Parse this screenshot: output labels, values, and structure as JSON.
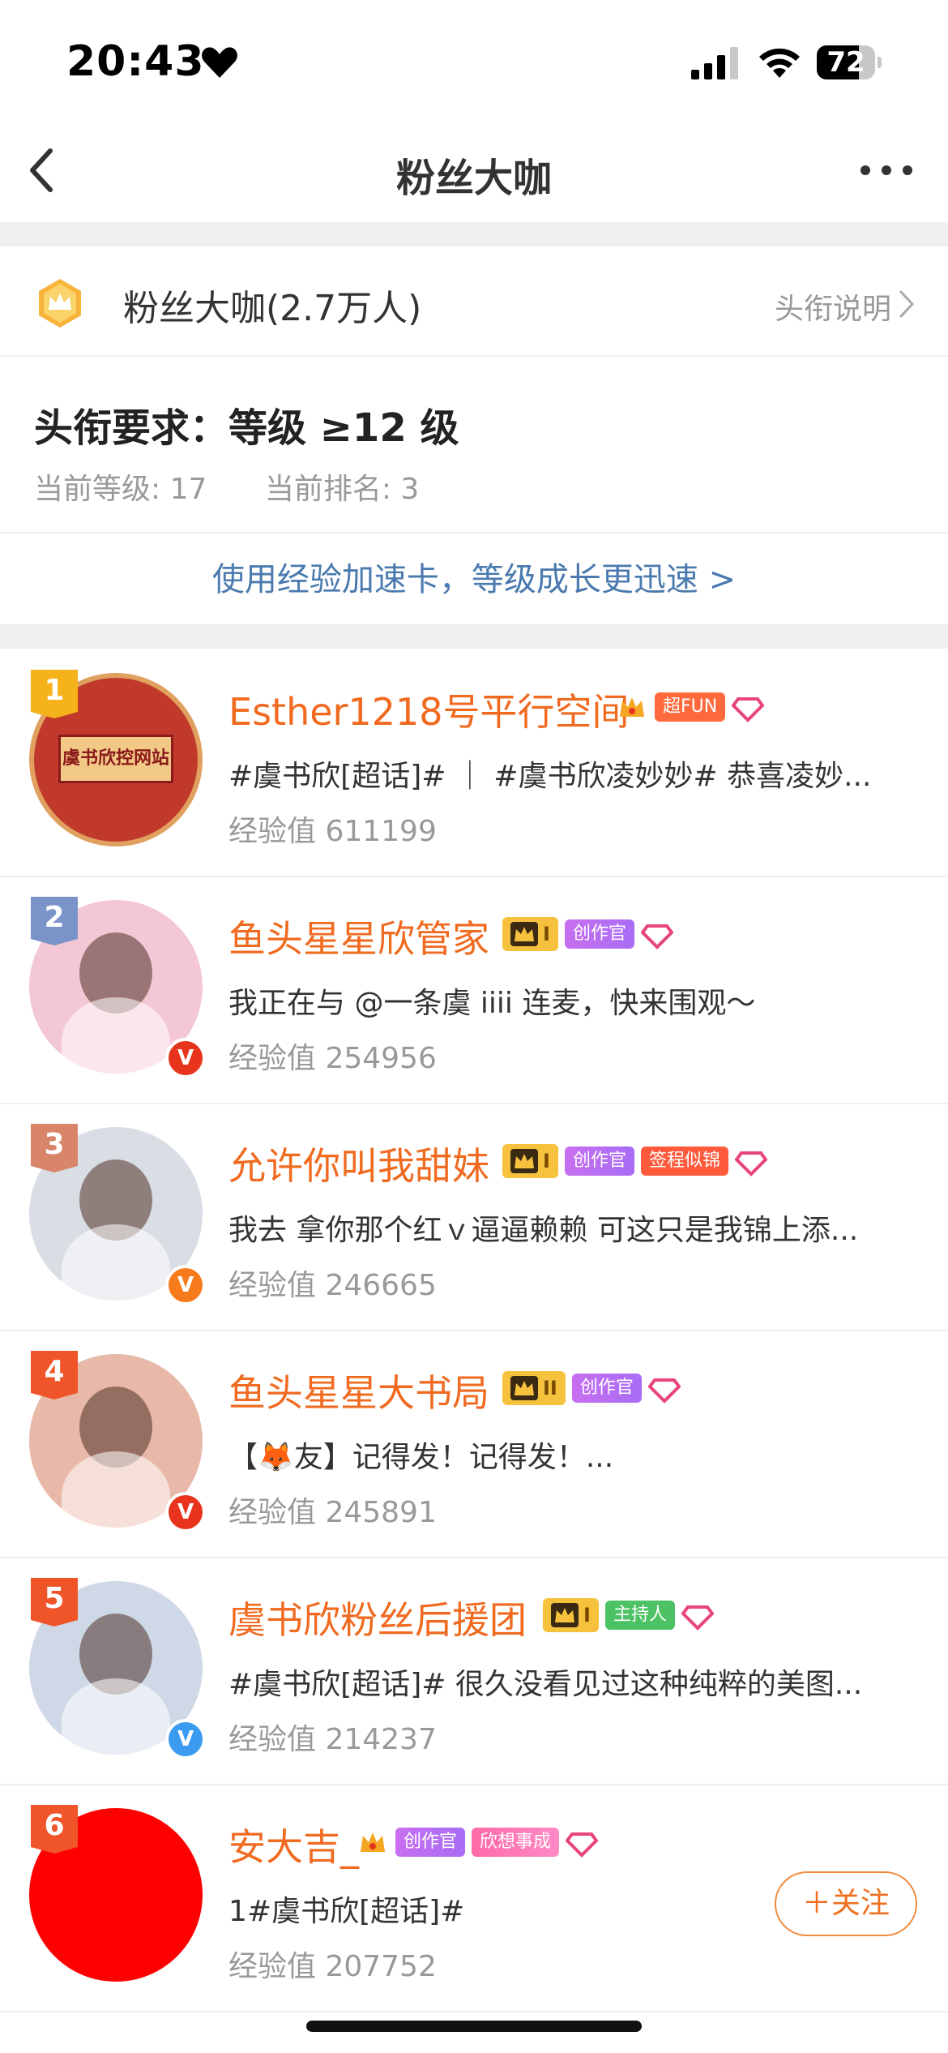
{
  "status_bar": {
    "time": "20:43",
    "battery": "72",
    "battery_level": 0.72
  },
  "nav": {
    "title": "粉丝大咖"
  },
  "group": {
    "name": "粉丝大咖(2.7万人)",
    "explain_label": "头衔说明"
  },
  "requirement": {
    "title": "头衔要求：等级 ≥12 级",
    "current_level": "当前等级: 17",
    "current_rank": "当前排名: 3"
  },
  "accel_link": "使用经验加速卡，等级成长更迅速 >",
  "ranking": [
    {
      "rank": "1",
      "name": "Esther1218号平行空间",
      "desc": "#虞书欣[超话]# ｜ #虞书欣凌妙妙# 恭喜凌妙...",
      "exp": "经验值 611199",
      "tags": [
        "超FUN"
      ],
      "avatar_color": "#c0392b",
      "verify": "",
      "avatar_text": "虞书欣控网站"
    },
    {
      "rank": "2",
      "name": "鱼头星星欣管家",
      "desc": "我正在与 @一条虞 iiii 连麦，快来围观～",
      "exp": "经验值 254956",
      "level": "I",
      "tags": [
        "创作官"
      ],
      "avatar_color": "#f4c7d6",
      "verify": "V"
    },
    {
      "rank": "3",
      "name": "允许你叫我甜妹",
      "desc": "我去 拿你那个红ｖ逼逼赖赖 可这只是我锦上添...",
      "exp": "经验值 246665",
      "level": "I",
      "tags": [
        "创作官",
        "签程似锦"
      ],
      "avatar_color": "#d9dde4",
      "verify": "V"
    },
    {
      "rank": "4",
      "name": "鱼头星星大书局",
      "desc": "【🦊友】记得发！记得发！...",
      "exp": "经验值 245891",
      "level": "II",
      "tags": [
        "创作官"
      ],
      "avatar_color": "#e8b9a8",
      "verify": "V"
    },
    {
      "rank": "5",
      "name": "虞书欣粉丝后援团",
      "desc": "#虞书欣[超话]# 很久没看见过这种纯粹的美图...",
      "exp": "经验值 214237",
      "level": "I",
      "tags": [
        "主持人"
      ],
      "avatar_color": "#cfd8e6",
      "verify": "V"
    },
    {
      "rank": "6",
      "name": "安大吉_",
      "desc": "1#虞书欣[超话]#",
      "exp": "经验值 207752",
      "tags": [
        "创作官",
        "欣想事成"
      ],
      "avatar_color": "#ff0000",
      "verify": "",
      "follow": "＋关注"
    }
  ],
  "colors": {
    "accent": "#f06a20",
    "link": "#4a7aaf",
    "rank_gold": "#f5b21b",
    "rank_red": "#f0552a"
  }
}
